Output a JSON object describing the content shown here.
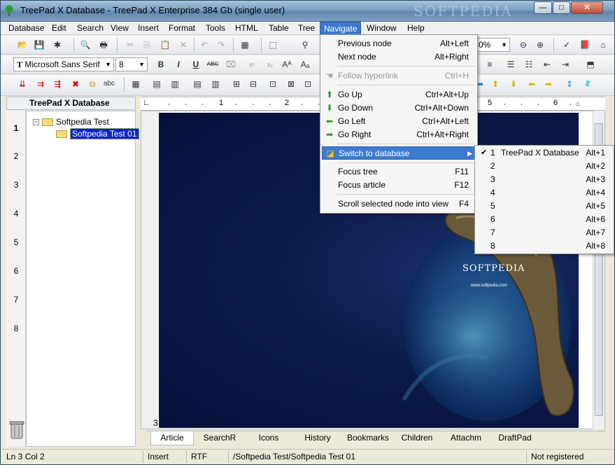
{
  "window": {
    "title": "TreePad X Database - TreePad X Enterprise 384 Gb (single user)",
    "watermark": "SOFTPEDIA",
    "controls": {
      "minimize": "—",
      "maximize": "□",
      "close": "✕"
    }
  },
  "menubar": {
    "items": [
      "Database",
      "Edit",
      "Search",
      "View",
      "Insert",
      "Format",
      "Tools",
      "HTML",
      "Table",
      "Tree",
      "Navigate",
      "Window",
      "Help"
    ],
    "active": "Navigate"
  },
  "toolbar": {
    "font_name": "Microsoft Sans Serif",
    "font_size": "8",
    "zoom": "0%"
  },
  "tree": {
    "header": "TreePad X Database",
    "line_numbers": [
      "1",
      "2",
      "3",
      "4",
      "5",
      "6",
      "7",
      "8"
    ],
    "nodes": [
      {
        "label": "Softpedia Test",
        "expander": "−"
      },
      {
        "label": "Softpedia Test 01"
      }
    ]
  },
  "ruler": {
    "numbers": [
      "1",
      "2",
      "5",
      "6"
    ]
  },
  "editor": {
    "current_line_number": "3",
    "image_logo": "SOFTPEDIA",
    "image_url": "www.softpedia.com"
  },
  "navigate_menu": {
    "items": [
      {
        "label": "Previous node",
        "shortcut": "Alt+Left",
        "icon": ""
      },
      {
        "label": "Next node",
        "shortcut": "Alt+Right",
        "icon": ""
      },
      {
        "label": "Follow hyperlink",
        "shortcut": "Ctrl+H",
        "icon": "hand-icon",
        "disabled": true
      },
      {
        "label": "Go Up",
        "shortcut": "Ctrl+Alt+Up",
        "icon": "arrow-up-icon"
      },
      {
        "label": "Go Down",
        "shortcut": "Ctrl+Alt+Down",
        "icon": "arrow-down-icon"
      },
      {
        "label": "Go Left",
        "shortcut": "Ctrl+Alt+Left",
        "icon": "arrow-left-icon"
      },
      {
        "label": "Go Right",
        "shortcut": "Ctrl+Alt+Right",
        "icon": "arrow-right-icon"
      },
      {
        "label": "Switch to database",
        "shortcut": "",
        "icon": "database-icon",
        "submenu": true
      },
      {
        "label": "Focus tree",
        "shortcut": "F11"
      },
      {
        "label": "Focus article",
        "shortcut": "F12"
      },
      {
        "label": "Scroll selected node into view",
        "shortcut": "F4"
      }
    ]
  },
  "database_submenu": {
    "items": [
      {
        "num": "1",
        "name": "TreePad X Database",
        "shortcut": "Alt+1",
        "checked": true
      },
      {
        "num": "2",
        "name": "",
        "shortcut": "Alt+2"
      },
      {
        "num": "3",
        "name": "",
        "shortcut": "Alt+3"
      },
      {
        "num": "4",
        "name": "",
        "shortcut": "Alt+4"
      },
      {
        "num": "5",
        "name": "",
        "shortcut": "Alt+5"
      },
      {
        "num": "6",
        "name": "",
        "shortcut": "Alt+6"
      },
      {
        "num": "7",
        "name": "",
        "shortcut": "Alt+7"
      },
      {
        "num": "8",
        "name": "",
        "shortcut": "Alt+8"
      }
    ]
  },
  "tabs": {
    "items": [
      "Article",
      "SearchR",
      "Icons",
      "History",
      "Bookmarks",
      "Children",
      "Attachm",
      "DraftPad"
    ],
    "active": "Article"
  },
  "statusbar": {
    "position": "Ln 3  Col 2",
    "mode": "Insert",
    "format": "RTF",
    "path": "/Softpedia Test/Softpedia Test 01",
    "registration": "Not registered"
  }
}
